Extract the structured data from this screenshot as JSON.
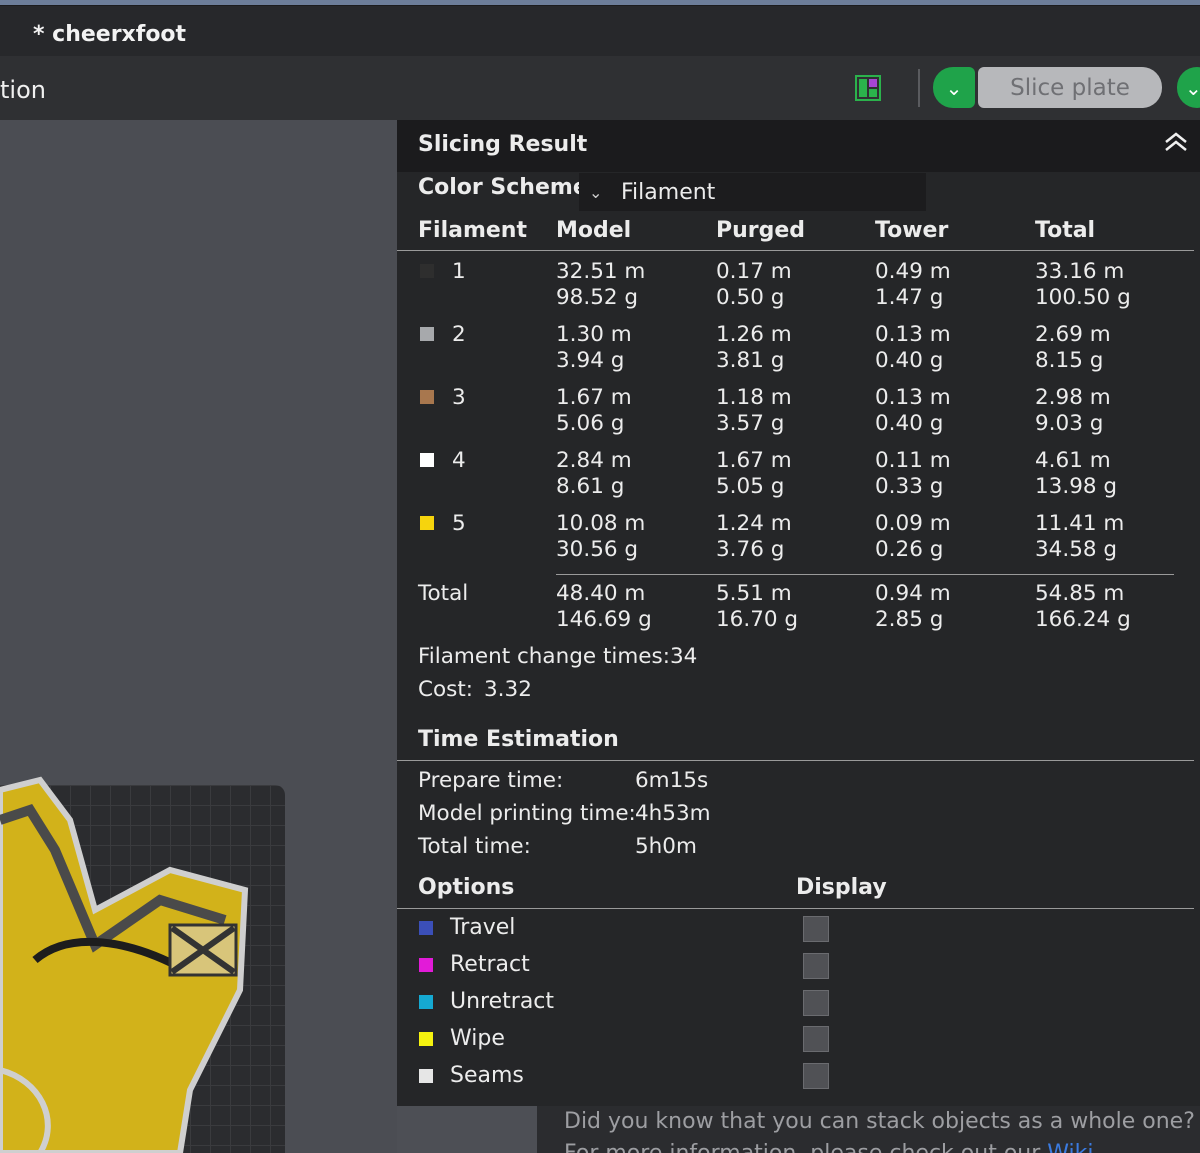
{
  "window": {
    "title": "* cheerxfoot"
  },
  "toolbar": {
    "tab_fragment": "tion",
    "slice_label": "Slice plate",
    "colors": {
      "accent_green": "#1fa34a"
    }
  },
  "panel": {
    "title": "Slicing Result",
    "color_scheme_label": "Color Scheme",
    "color_scheme_value": "Filament",
    "headers": [
      "Filament",
      "Model",
      "Purged",
      "Tower",
      "Total"
    ],
    "rows": [
      {
        "id": "1",
        "color": "#2e2e2e",
        "model_m": "32.51 m",
        "model_g": "98.52 g",
        "purged_m": "0.17 m",
        "purged_g": "0.50 g",
        "tower_m": "0.49 m",
        "tower_g": "1.47 g",
        "total_m": "33.16 m",
        "total_g": "100.50 g"
      },
      {
        "id": "2",
        "color": "#a7a9ac",
        "model_m": "1.30 m",
        "model_g": "3.94 g",
        "purged_m": "1.26 m",
        "purged_g": "3.81 g",
        "tower_m": "0.13 m",
        "tower_g": "0.40 g",
        "total_m": "2.69 m",
        "total_g": "8.15 g"
      },
      {
        "id": "3",
        "color": "#a8774e",
        "model_m": "1.67 m",
        "model_g": "5.06 g",
        "purged_m": "1.18 m",
        "purged_g": "3.57 g",
        "tower_m": "0.13 m",
        "tower_g": "0.40 g",
        "total_m": "2.98 m",
        "total_g": "9.03 g"
      },
      {
        "id": "4",
        "color": "#ffffff",
        "model_m": "2.84 m",
        "model_g": "8.61 g",
        "purged_m": "1.67 m",
        "purged_g": "5.05 g",
        "tower_m": "0.11 m",
        "tower_g": "0.33 g",
        "total_m": "4.61 m",
        "total_g": "13.98 g"
      },
      {
        "id": "5",
        "color": "#f6d40d",
        "model_m": "10.08 m",
        "model_g": "30.56 g",
        "purged_m": "1.24 m",
        "purged_g": "3.76 g",
        "tower_m": "0.09 m",
        "tower_g": "0.26 g",
        "total_m": "11.41 m",
        "total_g": "34.58 g"
      }
    ],
    "total_row": {
      "label": "Total",
      "model_m": "48.40 m",
      "model_g": "146.69 g",
      "purged_m": "5.51 m",
      "purged_g": "16.70 g",
      "tower_m": "0.94 m",
      "tower_g": "2.85 g",
      "total_m": "54.85 m",
      "total_g": "166.24 g"
    },
    "filament_change_label": "Filament change times:",
    "filament_change_value": "34",
    "cost_label": "Cost:",
    "cost_value": "3.32",
    "time": {
      "title": "Time Estimation",
      "prepare_label": "Prepare time:",
      "prepare_value": "6m15s",
      "model_label": "Model printing time:",
      "model_value": "4h53m",
      "total_label": "Total time:",
      "total_value": "5h0m"
    },
    "options_header": "Options",
    "display_header": "Display",
    "options": [
      {
        "label": "Travel",
        "color": "#3b4fb8"
      },
      {
        "label": "Retract",
        "color": "#e21bd8"
      },
      {
        "label": "Unretract",
        "color": "#15a9d2"
      },
      {
        "label": "Wipe",
        "color": "#f5f20f"
      },
      {
        "label": "Seams",
        "color": "#e6e6e6"
      }
    ]
  },
  "tip": {
    "line1": "Did you know that you can stack objects as a whole one?",
    "line2": "For more information, please check out our",
    "link": "Wiki"
  }
}
